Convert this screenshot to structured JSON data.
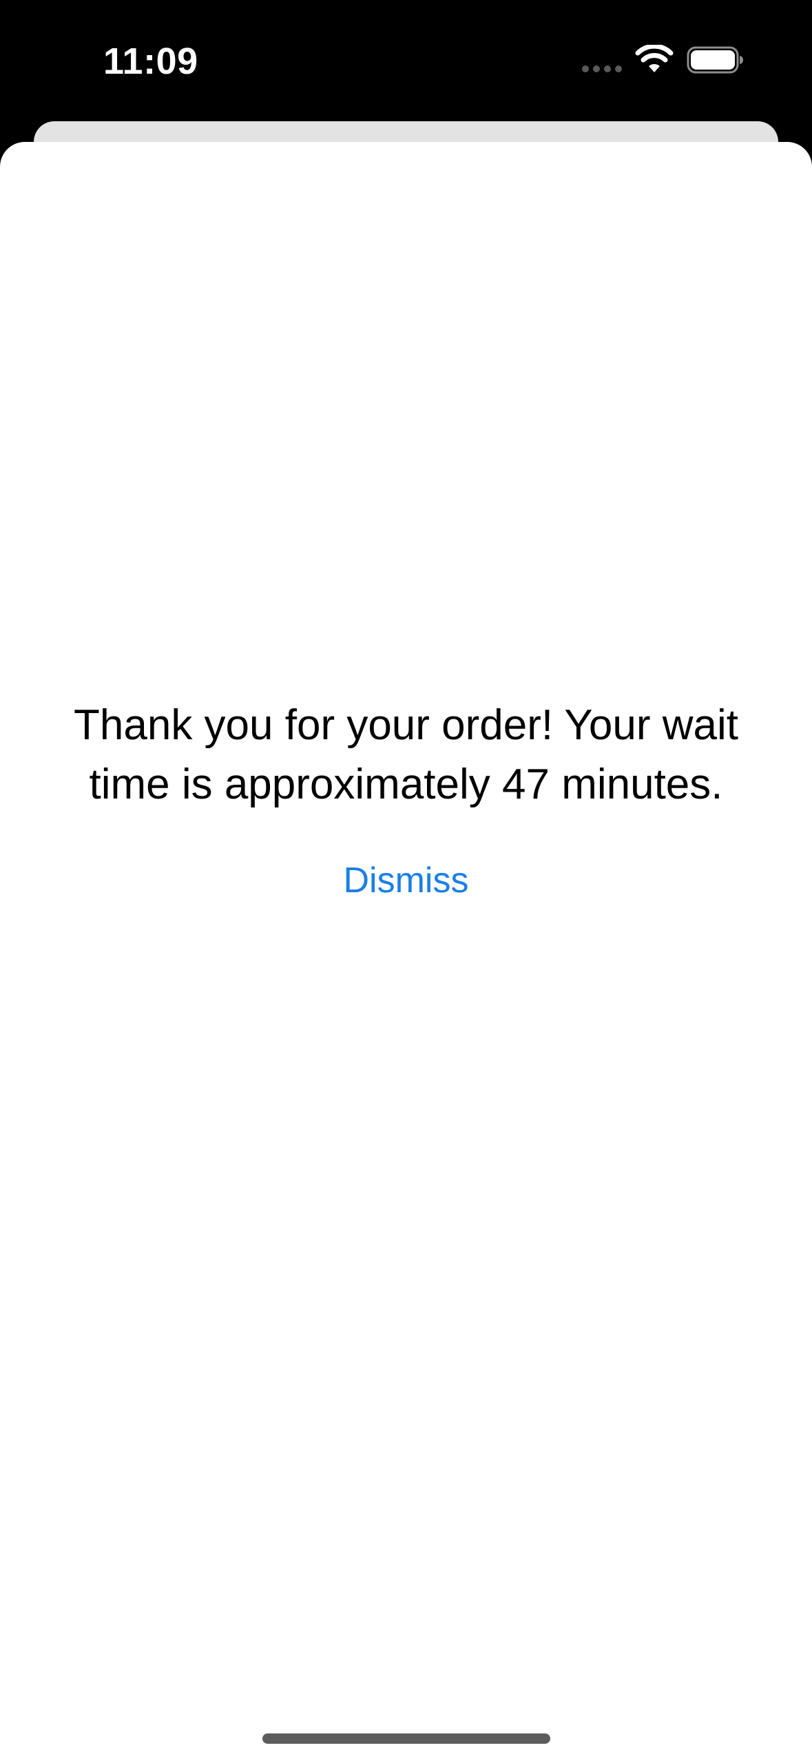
{
  "status_bar": {
    "time": "11:09",
    "icons": [
      "cellular-signal-icon",
      "wifi-icon",
      "battery-icon"
    ]
  },
  "sheet": {
    "message": "Thank you for your order! Your wait time is approximately 47 minutes.",
    "dismiss_label": "Dismiss"
  },
  "colors": {
    "accent": "#1a7ee6",
    "background": "#000000",
    "sheet": "#ffffff",
    "back_card": "#e3e3e3"
  }
}
